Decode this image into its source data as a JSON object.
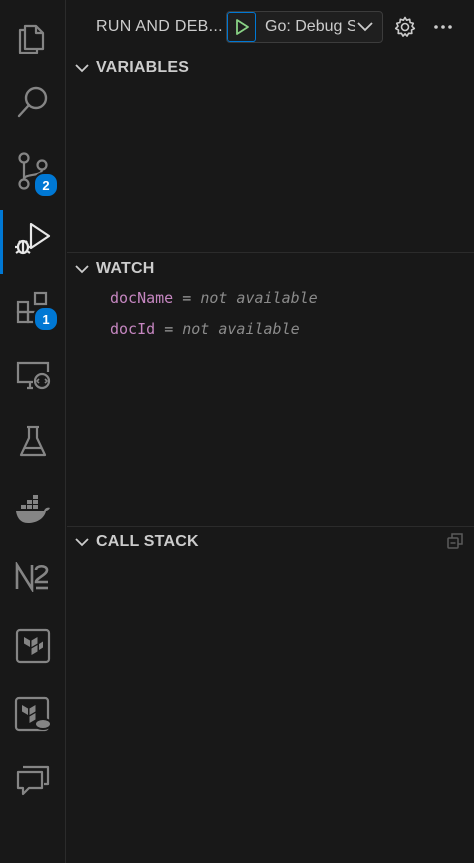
{
  "panel": {
    "title": "RUN AND DEB...",
    "config_label": "Go: Debug S",
    "play_icon": "play-icon",
    "settings_icon": "gear-icon",
    "more_icon": "ellipsis-icon"
  },
  "activity_bar": {
    "items": [
      {
        "icon": "files-icon",
        "badge": null
      },
      {
        "icon": "search-icon",
        "badge": null
      },
      {
        "icon": "source-control-icon",
        "badge": "2"
      },
      {
        "icon": "run-debug-icon",
        "badge": null,
        "active": true
      },
      {
        "icon": "extensions-icon",
        "badge": "1"
      },
      {
        "icon": "remote-explorer-icon",
        "badge": null
      },
      {
        "icon": "testing-flask-icon",
        "badge": null
      },
      {
        "icon": "docker-whale-icon",
        "badge": null
      },
      {
        "icon": "n2-icon",
        "badge": null
      },
      {
        "icon": "terraform-icon",
        "badge": null
      },
      {
        "icon": "terraform-cloud-icon",
        "badge": null
      },
      {
        "icon": "comments-icon",
        "badge": null
      }
    ]
  },
  "sections": {
    "variables": {
      "label": "VARIABLES"
    },
    "watch": {
      "label": "WATCH",
      "items": [
        {
          "name": "docName",
          "eq": "=",
          "value": "not available"
        },
        {
          "name": "docId",
          "eq": "=",
          "value": "not available"
        }
      ]
    },
    "call_stack": {
      "label": "CALL STACK"
    }
  },
  "colors": {
    "accent": "#0078d4",
    "background": "#181818",
    "watch_name": "#c586c0",
    "watch_value": "#8b8b8b"
  }
}
